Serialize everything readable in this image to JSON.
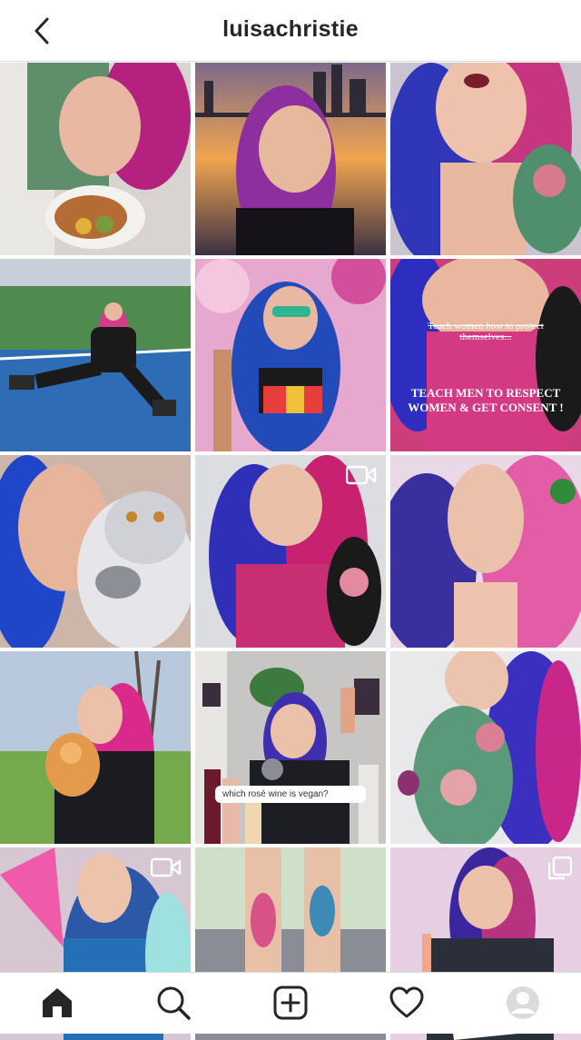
{
  "header": {
    "title": "luisachristie",
    "back_icon": "chevron-left-icon"
  },
  "posts": {
    "search_caption": "which rosé wine is vegan?",
    "overlay_line1": "Teach women how to protect themselves...",
    "overlay_line2": "TEACH MEN TO RESPECT WOMEN & GET CONSENT !",
    "video_icon": "video-camera-icon",
    "carousel_icon": "multiple-photos-icon"
  },
  "tabbar": {
    "items": [
      "home-icon",
      "search-icon",
      "add-post-icon",
      "heart-icon",
      "profile-avatar"
    ]
  },
  "colors": {
    "text": "#262626",
    "border": "#dbdbdb",
    "hair_pink": "#d6338f",
    "hair_blue": "#3a3fd6"
  }
}
